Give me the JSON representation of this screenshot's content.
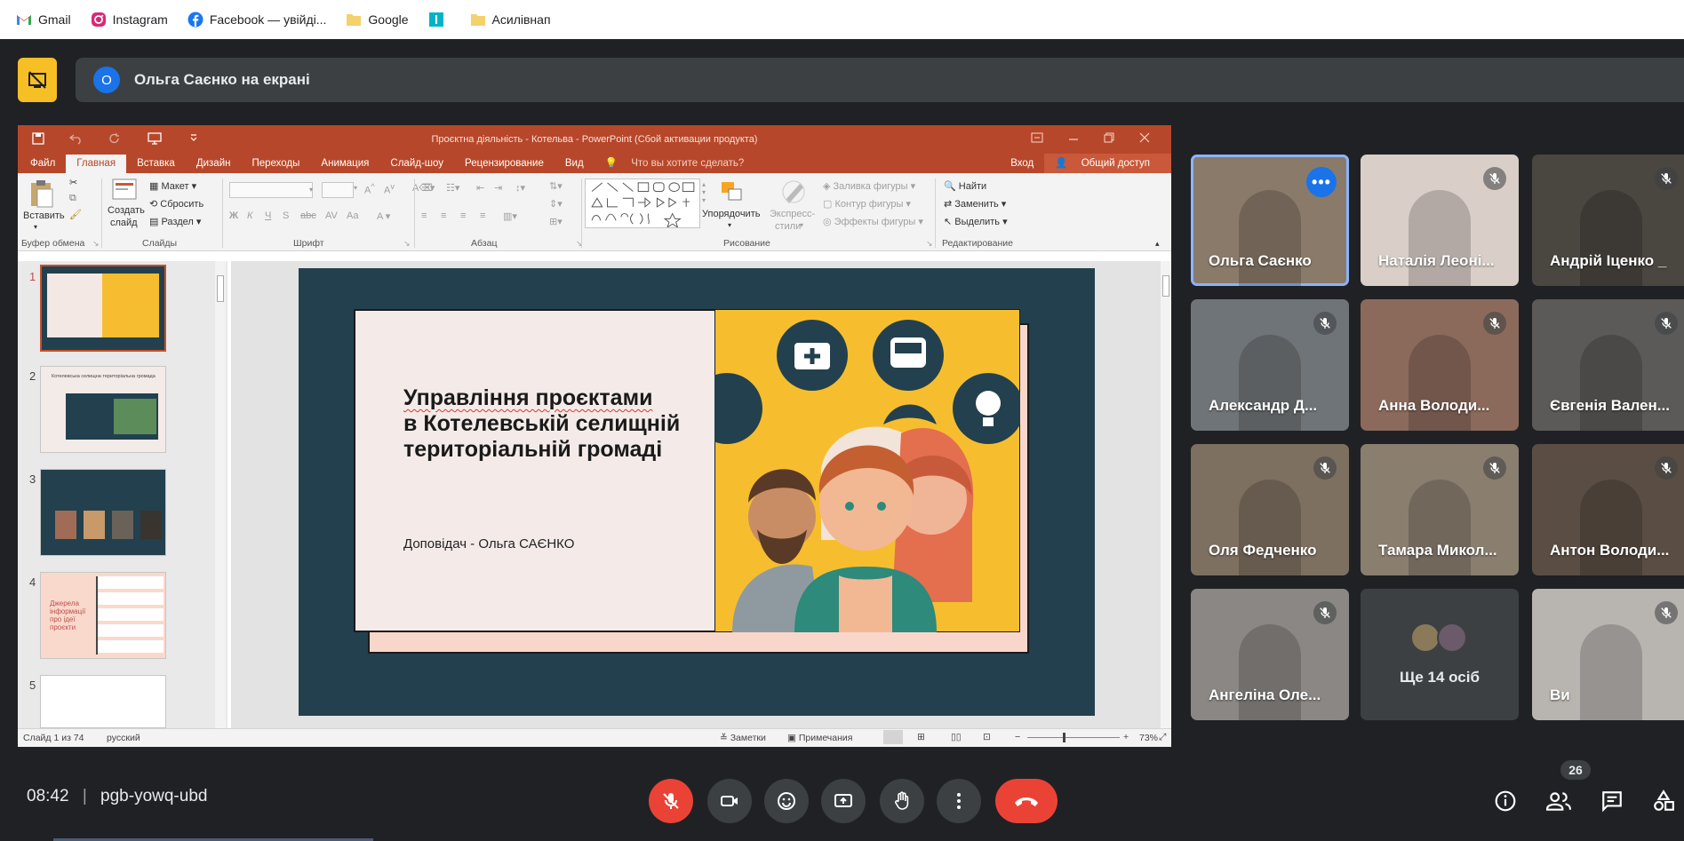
{
  "bookmarks": [
    {
      "label": "Gmail",
      "icon": "gmail-icon"
    },
    {
      "label": "Instagram",
      "icon": "instagram-icon"
    },
    {
      "label": "Facebook — увійді...",
      "icon": "facebook-icon"
    },
    {
      "label": "Google",
      "icon": "folder-icon"
    },
    {
      "label": "",
      "icon": "app-icon"
    },
    {
      "label": "Асилівнап",
      "icon": "folder-icon"
    }
  ],
  "presenting": {
    "badge": "О",
    "text": "Ольга Саєнко на екрані"
  },
  "ppt": {
    "title": "Проєктна діяльність - Котельва - PowerPoint (Сбой активации продукта)",
    "tabs": [
      "Файл",
      "Главная",
      "Вставка",
      "Дизайн",
      "Переходы",
      "Анимация",
      "Слайд-шоу",
      "Рецензирование",
      "Вид"
    ],
    "tell": "Что вы хотите сделать?",
    "signin": "Вход",
    "share": "Общий доступ",
    "ribbon": {
      "paste": "Вставить",
      "clipboard": "Буфер обмена",
      "create": "Создать",
      "slide": "слайд",
      "layout": "Макет",
      "reset": "Сбросить",
      "section": "Раздел",
      "slides": "Слайды",
      "font": "Шрифт",
      "paragraph": "Абзац",
      "arrange": "Упорядочить",
      "styles1": "Экспресс-",
      "styles2": "стили",
      "fill": "Заливка фигуры",
      "outline": "Контур фигуры",
      "effects": "Эффекты фигуры",
      "drawing": "Рисование",
      "find": "Найти",
      "replace": "Заменить",
      "select": "Выделить",
      "editing": "Редактирование"
    },
    "thumb_numbers": [
      "1",
      "2",
      "3",
      "4",
      "5"
    ],
    "thumb2_title": "Котелевська селищна територіальна громада",
    "thumb4_title": "Джерела інформації про ідеї проєкти",
    "slide": {
      "title_lines": [
        "Управління проєктами",
        "в Котелевській селищній",
        "територіальній громаді"
      ],
      "speaker": "Доповідач - Ольга САЄНКО"
    },
    "status": {
      "slide": "Слайд 1 из 74",
      "lang": "русский",
      "notes": "Заметки",
      "comments": "Примечания",
      "zoom": "73%"
    }
  },
  "participants": [
    {
      "name": "Ольга Саєнко",
      "muted": false,
      "active": true,
      "bg": "#8a7a6a"
    },
    {
      "name": "Наталія Леоні...",
      "muted": true,
      "bg": "#d9cfc8"
    },
    {
      "name": "Андрій Іценко _",
      "muted": true,
      "bg": "#4a4640"
    },
    {
      "name": "Александр Д...",
      "muted": true,
      "bg": "#6f7478"
    },
    {
      "name": "Анна Володи...",
      "muted": true,
      "bg": "#8b6a5c"
    },
    {
      "name": "Євгенія Вален...",
      "muted": true,
      "bg": "#5c5a58"
    },
    {
      "name": "Оля Федченко",
      "muted": true,
      "bg": "#7d7060"
    },
    {
      "name": "Тамара Микол...",
      "muted": true,
      "bg": "#8a7e6f"
    },
    {
      "name": "Антон Володи...",
      "muted": true,
      "bg": "#5a4e44"
    },
    {
      "name": "Ангеліна Оле...",
      "muted": true,
      "bg": "#8a8784"
    },
    {
      "name": "",
      "muted": false,
      "bg": "#3c4043"
    },
    {
      "name": "Ви",
      "muted": true,
      "bg": "#b8b4b0"
    }
  ],
  "more_label": "Ще 14 осіб",
  "bottom": {
    "time": "08:42",
    "separator": "|",
    "code": "pgb-yowq-ubd",
    "people_count": "26"
  },
  "colors": {
    "end_call": "#ea4335",
    "present_yellow": "#f6bf26",
    "ppt_orange": "#b7472a"
  }
}
